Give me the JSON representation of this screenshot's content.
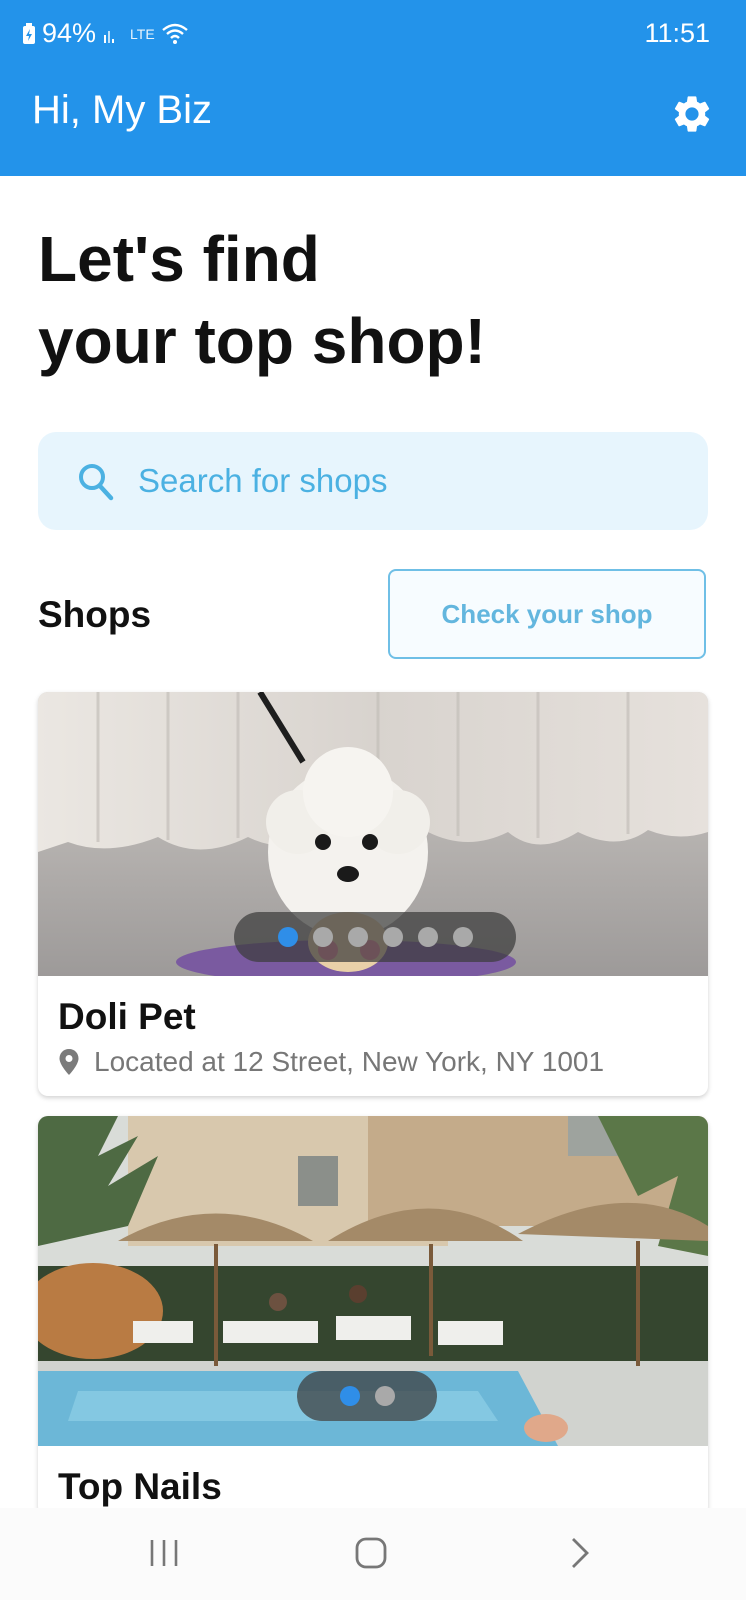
{
  "status": {
    "battery": "94%",
    "time": "11:51",
    "network": "LTE"
  },
  "header": {
    "greeting": "Hi, My Biz"
  },
  "hero": {
    "line1": "Let's find",
    "line2": "your top shop!"
  },
  "search": {
    "placeholder": "Search for shops"
  },
  "shops": {
    "title": "Shops",
    "check_label": "Check your shop",
    "items": [
      {
        "name": "Doli Pet",
        "address": "Located at 12 Street, New York, NY 1001",
        "image_count": 6,
        "active_index": 0
      },
      {
        "name": "Top Nails",
        "image_count": 2,
        "active_index": 0
      }
    ]
  },
  "colors": {
    "primary": "#2393ea",
    "search_bg": "#e7f5fd",
    "accent_text": "#4bb1e2",
    "dot_active": "#2f8ee8"
  },
  "icons": {
    "settings": "gear-icon",
    "search": "search-icon",
    "location": "location-pin-icon",
    "nav": [
      "recents-icon",
      "home-icon",
      "back-icon"
    ]
  }
}
